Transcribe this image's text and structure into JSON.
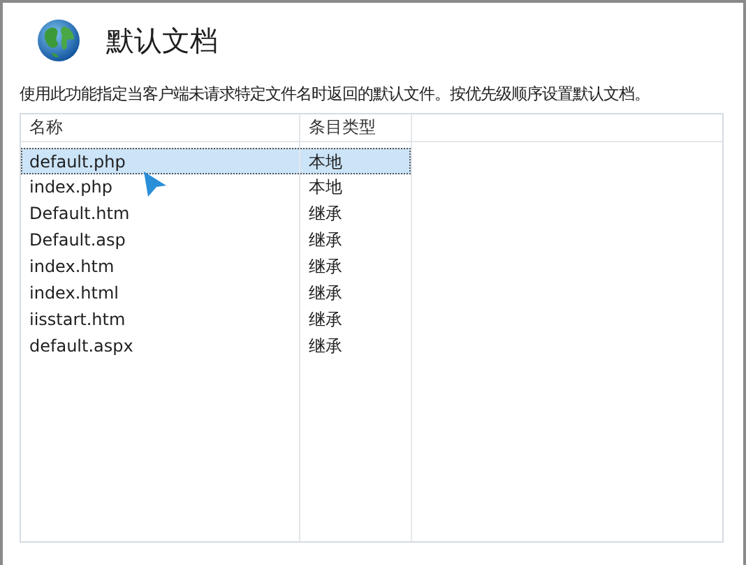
{
  "header": {
    "title": "默认文档"
  },
  "description": "使用此功能指定当客户端未请求特定文件名时返回的默认文件。按优先级顺序设置默认文档。",
  "table": {
    "columns": [
      "名称",
      "条目类型"
    ],
    "rows": [
      {
        "name": "default.php",
        "entry_type": "本地",
        "selected": true
      },
      {
        "name": "index.php",
        "entry_type": "本地",
        "selected": false
      },
      {
        "name": "Default.htm",
        "entry_type": "继承",
        "selected": false
      },
      {
        "name": "Default.asp",
        "entry_type": "继承",
        "selected": false
      },
      {
        "name": "index.htm",
        "entry_type": "继承",
        "selected": false
      },
      {
        "name": "index.html",
        "entry_type": "继承",
        "selected": false
      },
      {
        "name": "iisstart.htm",
        "entry_type": "继承",
        "selected": false
      },
      {
        "name": "default.aspx",
        "entry_type": "继承",
        "selected": false
      }
    ]
  }
}
